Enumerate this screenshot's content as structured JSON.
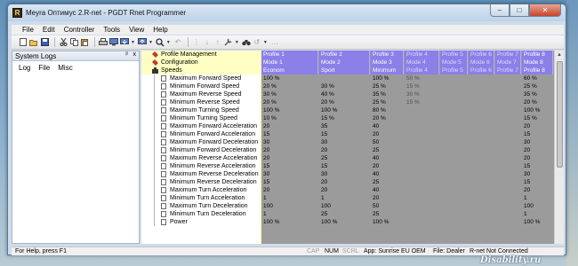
{
  "window": {
    "title": "Meyra Оптимус 2.R-net - PGDT Rnet Programmer",
    "app_icon_letter": "R"
  },
  "menu": [
    "File",
    "Edit",
    "Controller",
    "Tools",
    "View",
    "Help"
  ],
  "toolbar_icons": [
    "new-icon",
    "open-icon",
    "save-icon",
    "cut-icon",
    "copy-icon",
    "paste-icon",
    "print-icon",
    "connect-icon",
    "read-icon",
    "write-icon",
    "search-icon",
    "arrow-icon",
    "grid-icon",
    "download-icon",
    "upload-icon",
    "wrench-icon",
    "binoculars-icon",
    "undo-icon",
    "help-icon"
  ],
  "left_panel": {
    "title": "System Logs",
    "pin_glyph": "ᵖ",
    "close_glyph": "x",
    "tabs": [
      "Log",
      "File",
      "Misc"
    ]
  },
  "grid": {
    "columns": [
      "Profile 1",
      "Profile 2",
      "Profile 3",
      "Profile 4",
      "Profile 5",
      "Profile 6",
      "Profile 7",
      "Profile 8"
    ],
    "header_rows": [
      {
        "label": "Profile Management",
        "values": [
          "Profile 1",
          "Profile 2",
          "Profile 3",
          "Profile 4",
          "Profile 5",
          "Profile 6",
          "Profile 7",
          "Profile 8"
        ]
      },
      {
        "label": "Configuration",
        "values": [
          "Mode 1",
          "Mode 2",
          "Mode 3",
          "Mode 4",
          "Mode 5",
          "Mode 6",
          "Mode 7",
          "Mode 8"
        ]
      },
      {
        "label": "Speeds",
        "values": [
          "Econom",
          "Sport",
          "Minimum",
          "Profile 4",
          "Profile 5",
          "Profile 6",
          "Profile 7",
          "Profile 8"
        ]
      }
    ],
    "data_rows": [
      {
        "label": "Maximum Forward Speed",
        "values": [
          "100 %",
          "",
          "100 %",
          "50 %",
          "",
          "",
          "",
          "60 %"
        ]
      },
      {
        "label": "Minimum Forward Speed",
        "values": [
          "20 %",
          "30 %",
          "25 %",
          "15 %",
          "",
          "",
          "",
          "25 %"
        ]
      },
      {
        "label": "Maximum Reverse Speed",
        "values": [
          "30 %",
          "40 %",
          "35 %",
          "30 %",
          "",
          "",
          "",
          "35 %"
        ]
      },
      {
        "label": "Minimum Reverse Speed",
        "values": [
          "20 %",
          "20 %",
          "25 %",
          "15 %",
          "",
          "",
          "",
          "20 %"
        ]
      },
      {
        "label": "Maximum Turning Speed",
        "values": [
          "100 %",
          "100 %",
          "80 %",
          "",
          "",
          "",
          "",
          "100 %"
        ]
      },
      {
        "label": "Minimum Turning Speed",
        "values": [
          "10 %",
          "15 %",
          "20 %",
          "",
          "",
          "",
          "",
          "15 %"
        ]
      },
      {
        "label": "Maximum Forward Acceleration",
        "values": [
          "20",
          "35",
          "40",
          "",
          "",
          "",
          "",
          "20"
        ]
      },
      {
        "label": "Minimum Forward Acceleration",
        "values": [
          "15",
          "15",
          "20",
          "",
          "",
          "",
          "",
          "15"
        ]
      },
      {
        "label": "Maximum Forward Deceleration",
        "values": [
          "30",
          "30",
          "50",
          "",
          "",
          "",
          "",
          "30"
        ]
      },
      {
        "label": "Minimum Forward Deceleration",
        "values": [
          "20",
          "20",
          "25",
          "",
          "",
          "",
          "",
          "20"
        ]
      },
      {
        "label": "Maximum Reverse Acceleration",
        "values": [
          "20",
          "25",
          "40",
          "",
          "",
          "",
          "",
          "20"
        ]
      },
      {
        "label": "Minimum Reverse Acceleration",
        "values": [
          "15",
          "15",
          "20",
          "",
          "",
          "",
          "",
          "15"
        ]
      },
      {
        "label": "Maximum Reverse Deceleration",
        "values": [
          "30",
          "30",
          "40",
          "",
          "",
          "",
          "",
          "30"
        ]
      },
      {
        "label": "Minimum Reverse Deceleration",
        "values": [
          "15",
          "20",
          "25",
          "",
          "",
          "",
          "",
          "15"
        ]
      },
      {
        "label": "Maximum Turn Acceleration",
        "values": [
          "20",
          "20",
          "40",
          "",
          "",
          "",
          "",
          "20"
        ]
      },
      {
        "label": "Minimum Turn Acceleration",
        "values": [
          "1",
          "1",
          "20",
          "",
          "",
          "",
          "",
          "1"
        ]
      },
      {
        "label": "Maximum Turn Deceleration",
        "values": [
          "100",
          "100",
          "50",
          "",
          "",
          "",
          "",
          "100"
        ]
      },
      {
        "label": "Minimum Turn Deceleration",
        "values": [
          "1",
          "25",
          "25",
          "",
          "",
          "",
          "",
          "1"
        ]
      },
      {
        "label": "Power",
        "values": [
          "100 %",
          "100 %",
          "100 %",
          "",
          "",
          "",
          "",
          "100 %"
        ]
      }
    ]
  },
  "status": {
    "help_text": "For Help, press F1",
    "cap": "CAP",
    "num": "NUM",
    "scrl": "SCRL",
    "app": "App: Sunrise EU OEM",
    "file": "File: Dealer",
    "connection": "R-net Not Connected"
  },
  "watermark": "Disability.ru",
  "colors": {
    "header_purple": "#8b7fe8",
    "label_yellow": "#ffffc4",
    "grid_gray": "#9b9b9b"
  }
}
